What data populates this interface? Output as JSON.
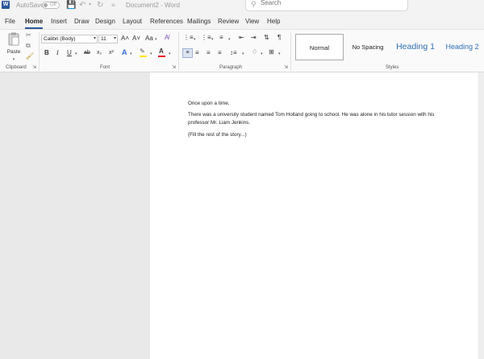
{
  "titlebar": {
    "app_logo": "W",
    "autosave_label": "AutoSave",
    "autosave_state": "Off",
    "doc_title": "Document2 - Word",
    "search_placeholder": "Search"
  },
  "menu": {
    "tabs": [
      "File",
      "Home",
      "Insert",
      "Draw",
      "Design",
      "Layout",
      "References",
      "Mailings",
      "Review",
      "View",
      "Help"
    ],
    "active": "Home"
  },
  "ribbon": {
    "clipboard": {
      "paste_label": "Paste",
      "group_label": "Clipboard"
    },
    "font": {
      "font_name": "Calibri (Body)",
      "font_size": "11",
      "grow": "A˄",
      "shrink": "A˅",
      "case": "Aa",
      "bold": "B",
      "italic": "I",
      "underline": "U",
      "strikethrough": "ab",
      "subscript": "x₂",
      "superscript": "x²",
      "text_effects": "A",
      "font_color": "A",
      "group_label": "Font",
      "highlight_color": "#ffe600",
      "font_color_bar": "#e81123",
      "effects_color": "#2b6fd6"
    },
    "paragraph": {
      "group_label": "Paragraph",
      "pilcrow": "¶"
    },
    "styles": {
      "items": [
        "Normal",
        "No Spacing",
        "Heading 1",
        "Heading 2"
      ],
      "group_label": "Styles"
    }
  },
  "document": {
    "paragraphs": [
      "Once upon a time,",
      "There was a university student named Tom Holland going to school. He was alone in his tutor session with his professor Mr. Liam Jenkins.",
      "(Fill the rest of the story...)"
    ]
  },
  "colors": {
    "accent": "#2b579a",
    "canvas": "#e9e9e9"
  }
}
